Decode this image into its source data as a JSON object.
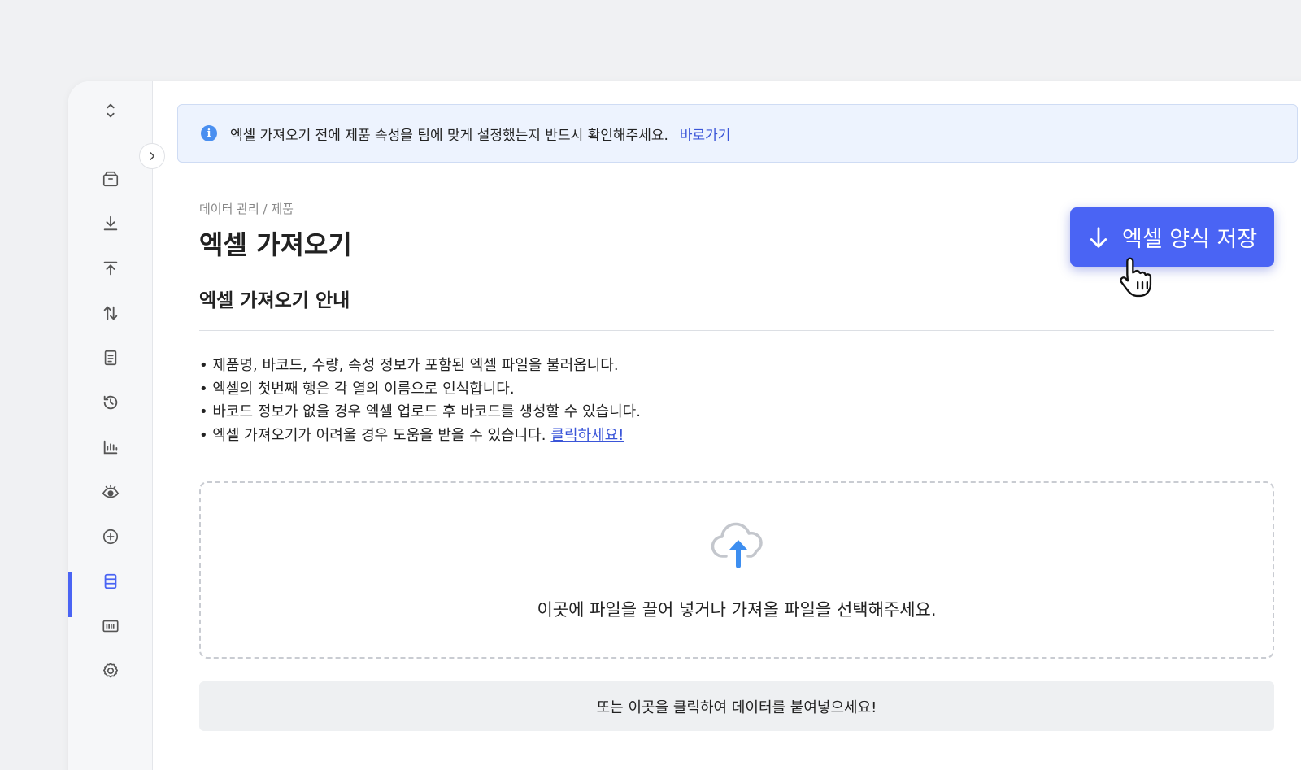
{
  "notice": {
    "text": "엑셀 가져오기 전에 제품 속성을 팀에 맞게 설정했는지 반드시 확인해주세요.",
    "link": "바로가기"
  },
  "breadcrumb": "데이터 관리 / 제품",
  "page_title": "엑셀 가져오기",
  "save_button_label": "엑셀 양식 저장",
  "guide": {
    "title": "엑셀 가져오기 안내",
    "items": [
      "제품명, 바코드, 수량, 속성 정보가 포함된 엑셀 파일을 불러옵니다.",
      "엑셀의 첫번째 행은 각 열의 이름으로 인식합니다.",
      "바코드 정보가 없을 경우 엑셀 업로드 후 바코드를 생성할 수 있습니다.",
      "엑셀 가져오기가 어려울 경우 도움을 받을 수 있습니다."
    ],
    "help_link": "클릭하세요!"
  },
  "dropzone_text": "이곳에 파일을 끌어 넣거나 가져올 파일을 선택해주세요.",
  "paste_text": "또는 이곳을 클릭하여 데이터를 붙여넣으세요!",
  "sidebar_icons": [
    "expand-collapse-icon",
    "box-icon",
    "download-icon",
    "upload-icon",
    "transfer-icon",
    "document-icon",
    "history-icon",
    "chart-icon",
    "eye-icon",
    "add-circle-icon",
    "database-icon",
    "barcode-icon",
    "gear-icon"
  ],
  "colors": {
    "accent": "#4a64f4",
    "link": "#3a55d8",
    "notice_bg": "#edf3fe",
    "info": "#4a8ff0",
    "upload_arrow": "#3d8ef0"
  }
}
